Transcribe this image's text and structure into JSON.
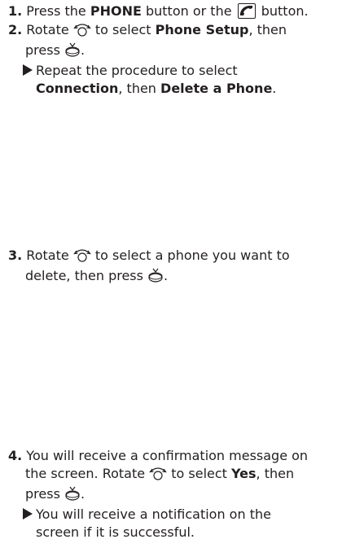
{
  "steps": [
    {
      "number": "1.",
      "text_a": " Press the ",
      "bold_a": "PHONE",
      "text_b": " button or the ",
      "text_c": " button."
    },
    {
      "number": "2.",
      "text_a": " Rotate ",
      "text_b": " to select ",
      "bold_a": "Phone Setup",
      "text_c": ", then",
      "line2_a": "press ",
      "line2_b": ".",
      "note_line1": "Repeat the procedure to select",
      "note_bold_a": "Connection",
      "note_text": ", then ",
      "note_bold_b": "Delete a Phone",
      "note_end": "."
    },
    {
      "number": "3.",
      "text_a": " Rotate ",
      "text_b": " to select a phone you want to",
      "line2_a": "delete, then press ",
      "line2_b": "."
    },
    {
      "number": "4.",
      "text_a": " You will receive a confirmation message on",
      "line2_a": "the screen. Rotate ",
      "line2_b": " to select ",
      "line2_bold": "Yes",
      "line2_c": ", then",
      "line3_a": "press ",
      "line3_b": ".",
      "note_line1": "You will receive a notification on the",
      "note_line2": "screen if it is successful."
    }
  ],
  "icons": {
    "phone_button": "phone-handset-icon",
    "selector_knob": "rotate-knob-icon",
    "press_knob": "press-knob-icon"
  }
}
